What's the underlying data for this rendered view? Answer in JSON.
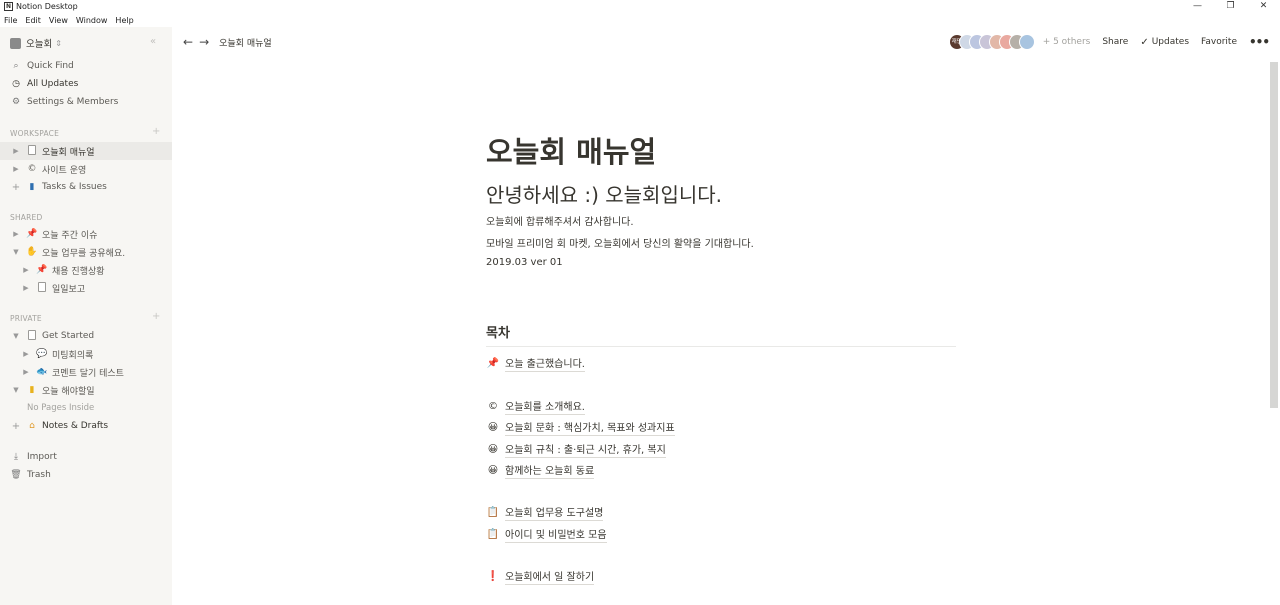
{
  "window": {
    "title": "Notion Desktop",
    "controls": [
      "—",
      "❐",
      "✕"
    ]
  },
  "menu": [
    "File",
    "Edit",
    "View",
    "Window",
    "Help"
  ],
  "sidebar": {
    "workspace_name": "오늘회",
    "quick_find": "Quick Find",
    "all_updates": "All Updates",
    "settings": "Settings & Members",
    "workspace_section": "WORKSPACE",
    "workspace_items": [
      {
        "label": "오늘회 매뉴얼",
        "icon": "doc-icon"
      },
      {
        "label": "사이트 운영",
        "icon": "copyright-icon"
      },
      {
        "label": "Tasks & Issues",
        "icon": "book-icon"
      }
    ],
    "shared_section": "SHARED",
    "shared_items": [
      {
        "label": "오늘 주간 이슈",
        "icon": "pin-icon"
      },
      {
        "label": "오늘 업무를 공유해요.",
        "icon": "hand-icon"
      },
      {
        "label": "채용 진행상황",
        "icon": "pin-icon"
      },
      {
        "label": "일일보고",
        "icon": "doc-icon"
      }
    ],
    "private_section": "PRIVATE",
    "private_items": [
      {
        "label": "Get Started",
        "icon": "doc-icon"
      },
      {
        "label": "미팅회의록",
        "icon": "speech-icon"
      },
      {
        "label": "코멘트 달기 테스트",
        "icon": "fish-icon"
      },
      {
        "label": "오늘 해야할일",
        "icon": "notebook-icon"
      },
      {
        "label": "Notes & Drafts",
        "icon": "house-icon"
      }
    ],
    "no_pages": "No Pages Inside",
    "import": "Import",
    "trash": "Trash"
  },
  "topbar": {
    "breadcrumb": "오늘회 매뉴얼",
    "avatars": [
      {
        "label": "재민",
        "color": "#5a3a2e"
      },
      {
        "label": "",
        "color": "#cfd8e6"
      },
      {
        "label": "",
        "color": "#bcc6e0"
      },
      {
        "label": "",
        "color": "#c9c5d8"
      },
      {
        "label": "",
        "color": "#e2b8a8"
      },
      {
        "label": "",
        "color": "#e9a9a0"
      },
      {
        "label": "",
        "color": "#b6b0a8"
      },
      {
        "label": "",
        "color": "#a8c4e0"
      }
    ],
    "others": "+ 5 others",
    "share": "Share",
    "updates": "Updates",
    "favorite": "Favorite"
  },
  "page": {
    "title": "오늘회 매뉴얼",
    "heading": "안녕하세요 :) 오늘회입니다.",
    "paragraphs": [
      "오늘회에 합류해주셔서 감사합니다.",
      "모바일 프리미엄 회 마켓, 오늘회에서 당신의 활약을 기대합니다.",
      "2019.03 ver 01"
    ],
    "toc_heading": "목차",
    "toc": [
      {
        "icon": "📌",
        "icon_name": "pin-icon",
        "text": "오늘 출근했습니다."
      },
      {
        "icon": "©",
        "icon_name": "copyright-icon",
        "text": "오늘회를 소개해요."
      },
      {
        "icon": "😀",
        "icon_name": "smile-icon",
        "text": "오늘회 문화 : 핵심가치, 목표와 성과지표"
      },
      {
        "icon": "😀",
        "icon_name": "smile-icon",
        "text": "오늘회 규칙 : 출·퇴근 시간, 휴가, 복지"
      },
      {
        "icon": "😀",
        "icon_name": "smile-icon",
        "text": "함께하는 오늘회 동료"
      },
      {
        "icon": "📋",
        "icon_name": "clipboard-icon",
        "text": "오늘회 업무용 도구설명"
      },
      {
        "icon": "📋",
        "icon_name": "clipboard-icon",
        "text": "아이디 및 비밀번호 모음"
      },
      {
        "icon": "❗",
        "icon_name": "exclamation-icon",
        "text": "오늘회에서 일 잘하기"
      }
    ]
  }
}
